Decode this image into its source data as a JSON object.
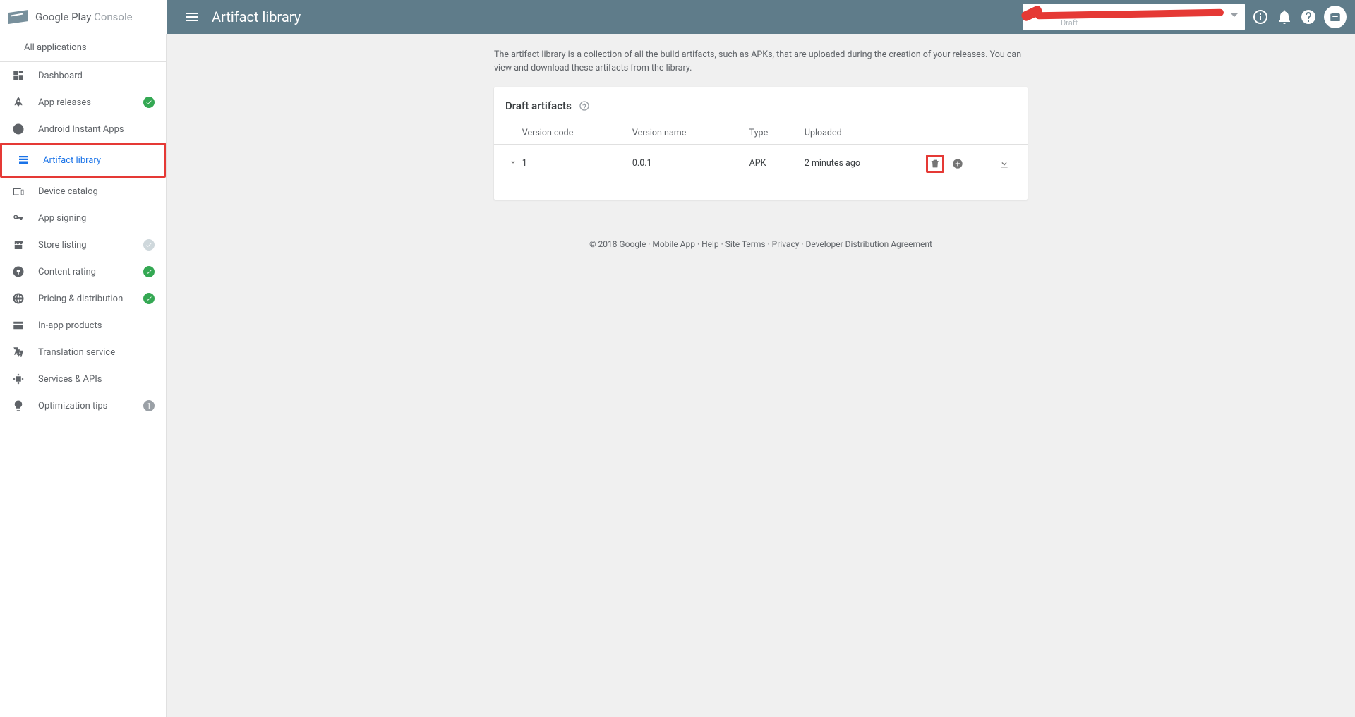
{
  "header": {
    "brand_prefix": "Google Play ",
    "brand_suffix": "Console",
    "page_title": "Artifact library",
    "app_selector": {
      "status_label": "Draft"
    }
  },
  "sidebar": {
    "back_label": "All applications",
    "items": [
      {
        "label": "Dashboard",
        "icon": "dashboard"
      },
      {
        "label": "App releases",
        "icon": "rocket",
        "status": "ok"
      },
      {
        "label": "Android Instant Apps",
        "icon": "bolt"
      },
      {
        "label": "Artifact library",
        "icon": "library",
        "active": true
      },
      {
        "label": "Device catalog",
        "icon": "devices"
      },
      {
        "label": "App signing",
        "icon": "key"
      },
      {
        "label": "Store listing",
        "icon": "store",
        "status": "muted"
      },
      {
        "label": "Content rating",
        "icon": "rating",
        "status": "ok"
      },
      {
        "label": "Pricing & distribution",
        "icon": "globe",
        "status": "ok"
      },
      {
        "label": "In-app products",
        "icon": "card"
      },
      {
        "label": "Translation service",
        "icon": "translate"
      },
      {
        "label": "Services & APIs",
        "icon": "api"
      },
      {
        "label": "Optimization tips",
        "icon": "bulb",
        "status": "count",
        "count": "1"
      }
    ]
  },
  "main": {
    "intro": "The artifact library is a collection of all the build artifacts, such as APKs, that are uploaded during the creation of your releases. You can view and download these artifacts from the library.",
    "card_title": "Draft artifacts",
    "columns": {
      "version_code": "Version code",
      "version_name": "Version name",
      "type": "Type",
      "uploaded": "Uploaded"
    },
    "rows": [
      {
        "version_code": "1",
        "version_name": "0.0.1",
        "type": "APK",
        "uploaded": "2 minutes ago"
      }
    ]
  },
  "footer": {
    "copyright": "© 2018 Google",
    "links": [
      "Mobile App",
      "Help",
      "Site Terms",
      "Privacy",
      "Developer Distribution Agreement"
    ]
  }
}
